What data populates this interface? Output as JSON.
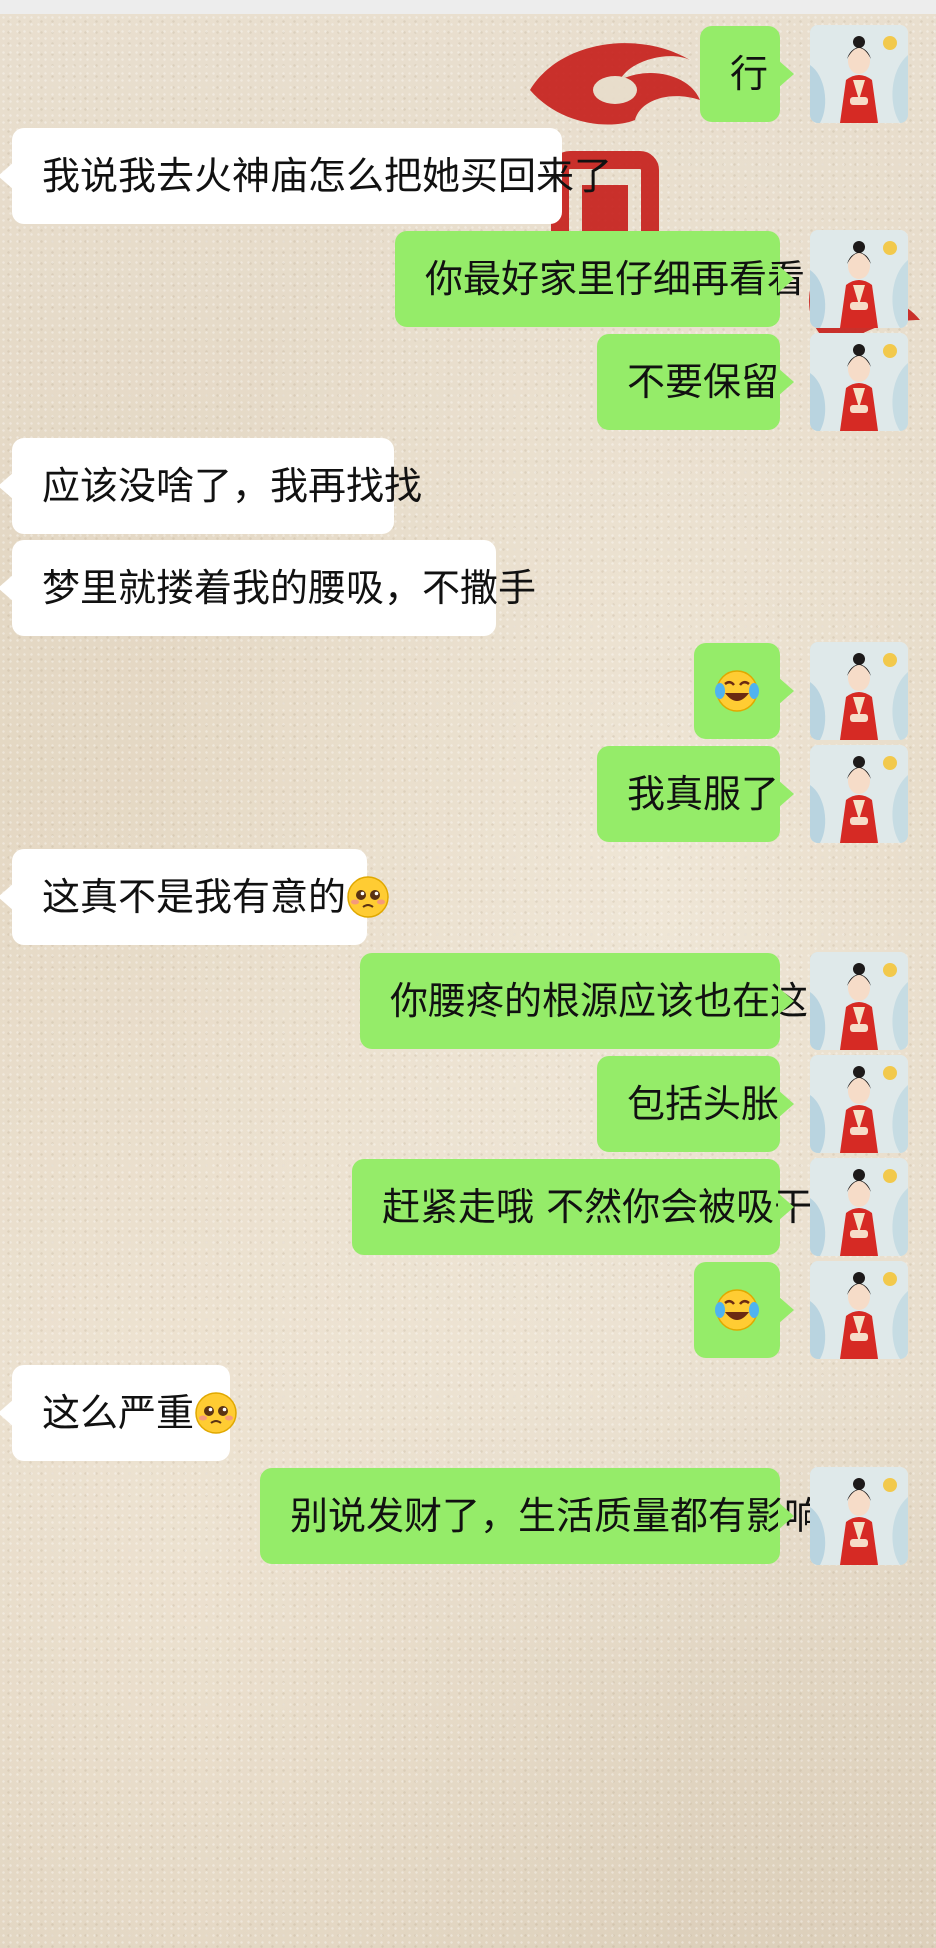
{
  "messages": [
    {
      "side": "out",
      "text": "行",
      "emoji": null
    },
    {
      "side": "in",
      "text": "我说我去火神庙怎么把她买回来了",
      "emoji": null
    },
    {
      "side": "out",
      "text": "你最好家里仔细再看看",
      "emoji": null
    },
    {
      "side": "out",
      "text": "不要保留",
      "emoji": null
    },
    {
      "side": "in",
      "text": "应该没啥了，我再找找",
      "emoji": null
    },
    {
      "side": "in",
      "text": "梦里就搂着我的腰吸，不撒手",
      "emoji": null
    },
    {
      "side": "out",
      "text": "",
      "emoji": "crying-laughing-face"
    },
    {
      "side": "out",
      "text": "我真服了",
      "emoji": null
    },
    {
      "side": "in",
      "text": "这真不是我有意的",
      "emoji": "pleading-face"
    },
    {
      "side": "out",
      "text": "你腰疼的根源应该也在这",
      "emoji": null
    },
    {
      "side": "out",
      "text": "包括头胀",
      "emoji": null
    },
    {
      "side": "out",
      "text": "赶紧走哦 不然你会被吸干",
      "emoji": null
    },
    {
      "side": "out",
      "text": "",
      "emoji": "crying-laughing-face"
    },
    {
      "side": "in",
      "text": "这么严重",
      "emoji": "pleading-face"
    },
    {
      "side": "out",
      "text": "别说发财了，生活质量都有影响",
      "emoji": null
    }
  ],
  "colors": {
    "outgoing_bubble": "#95ec69",
    "incoming_bubble": "#ffffff",
    "background": "#e4d9c6"
  }
}
